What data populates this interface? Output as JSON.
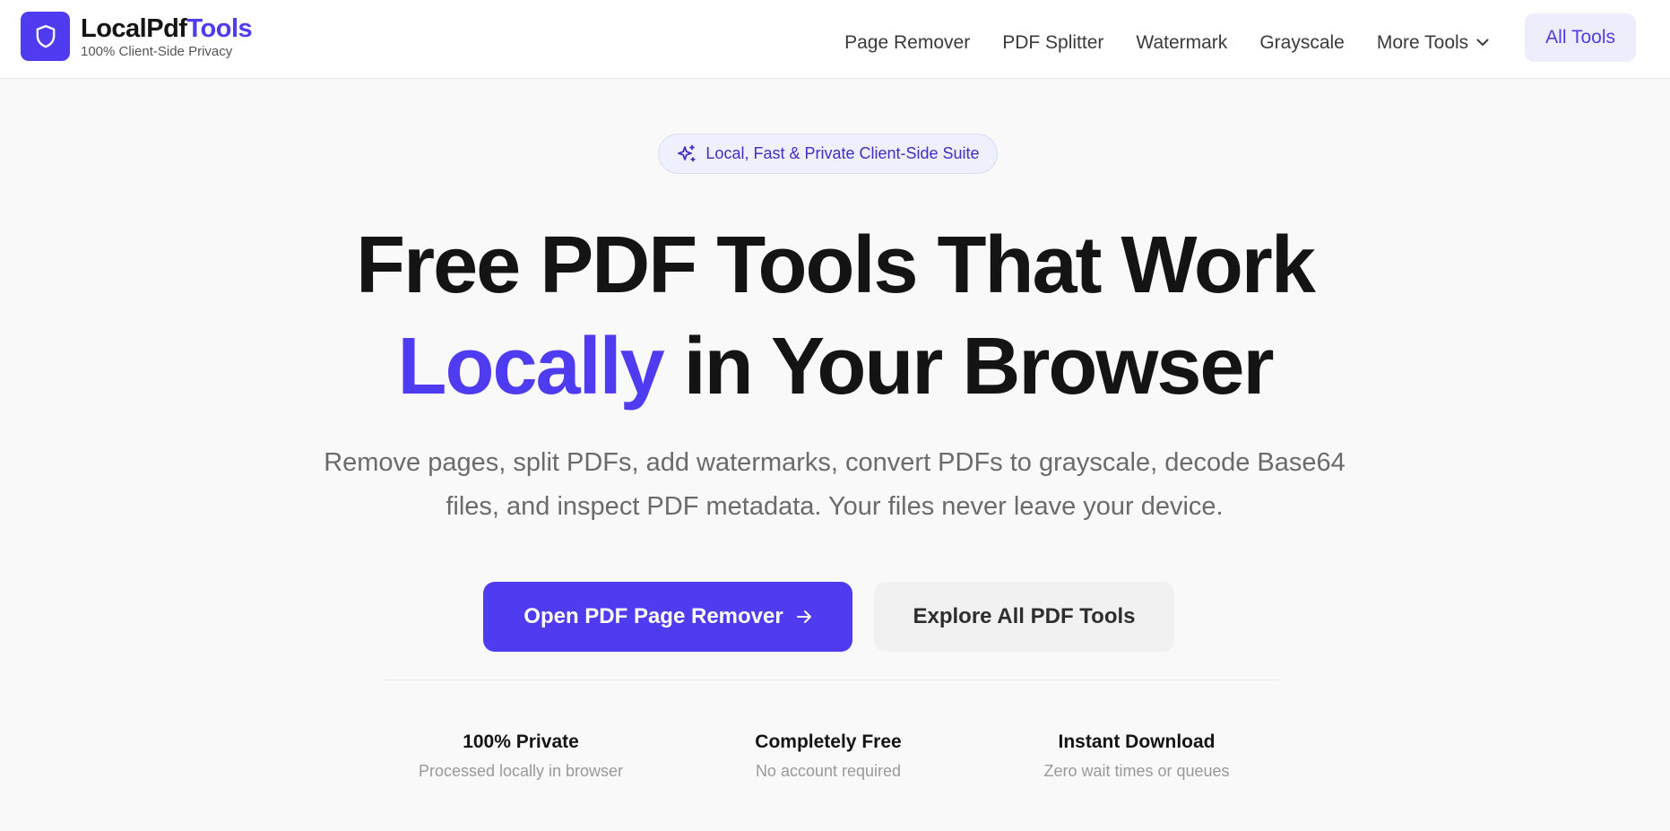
{
  "header": {
    "brand_part1": "LocalPdf",
    "brand_part2": "Tools",
    "tagline": "100% Client-Side Privacy",
    "nav": [
      {
        "label": "Page Remover"
      },
      {
        "label": "PDF Splitter"
      },
      {
        "label": "Watermark"
      },
      {
        "label": "Grayscale"
      }
    ],
    "more_label": "More Tools",
    "all_tools_label": "All Tools"
  },
  "hero": {
    "badge": "Local, Fast & Private Client-Side Suite",
    "title_line1": "Free PDF Tools That Work",
    "title_highlight": "Locally",
    "title_line2_rest": " in Your Browser",
    "subtitle": "Remove pages, split PDFs, add watermarks, convert PDFs to grayscale, decode Base64 files, and inspect PDF metadata. Your files never leave your device.",
    "primary_button": "Open PDF Page Remover",
    "secondary_button": "Explore All PDF Tools"
  },
  "features": [
    {
      "title": "100% Private",
      "desc": "Processed locally in browser"
    },
    {
      "title": "Completely Free",
      "desc": "No account required"
    },
    {
      "title": "Instant Download",
      "desc": "Zero wait times or queues"
    }
  ],
  "icons": {
    "logo": "shield-icon",
    "badge": "sparkles-icon",
    "more": "chevron-down-icon",
    "primary_button": "arrow-right-icon"
  },
  "colors": {
    "accent": "#4f3cf0",
    "accent_soft": "#eeedfc",
    "text": "#141414",
    "muted": "#6b6b6b"
  }
}
